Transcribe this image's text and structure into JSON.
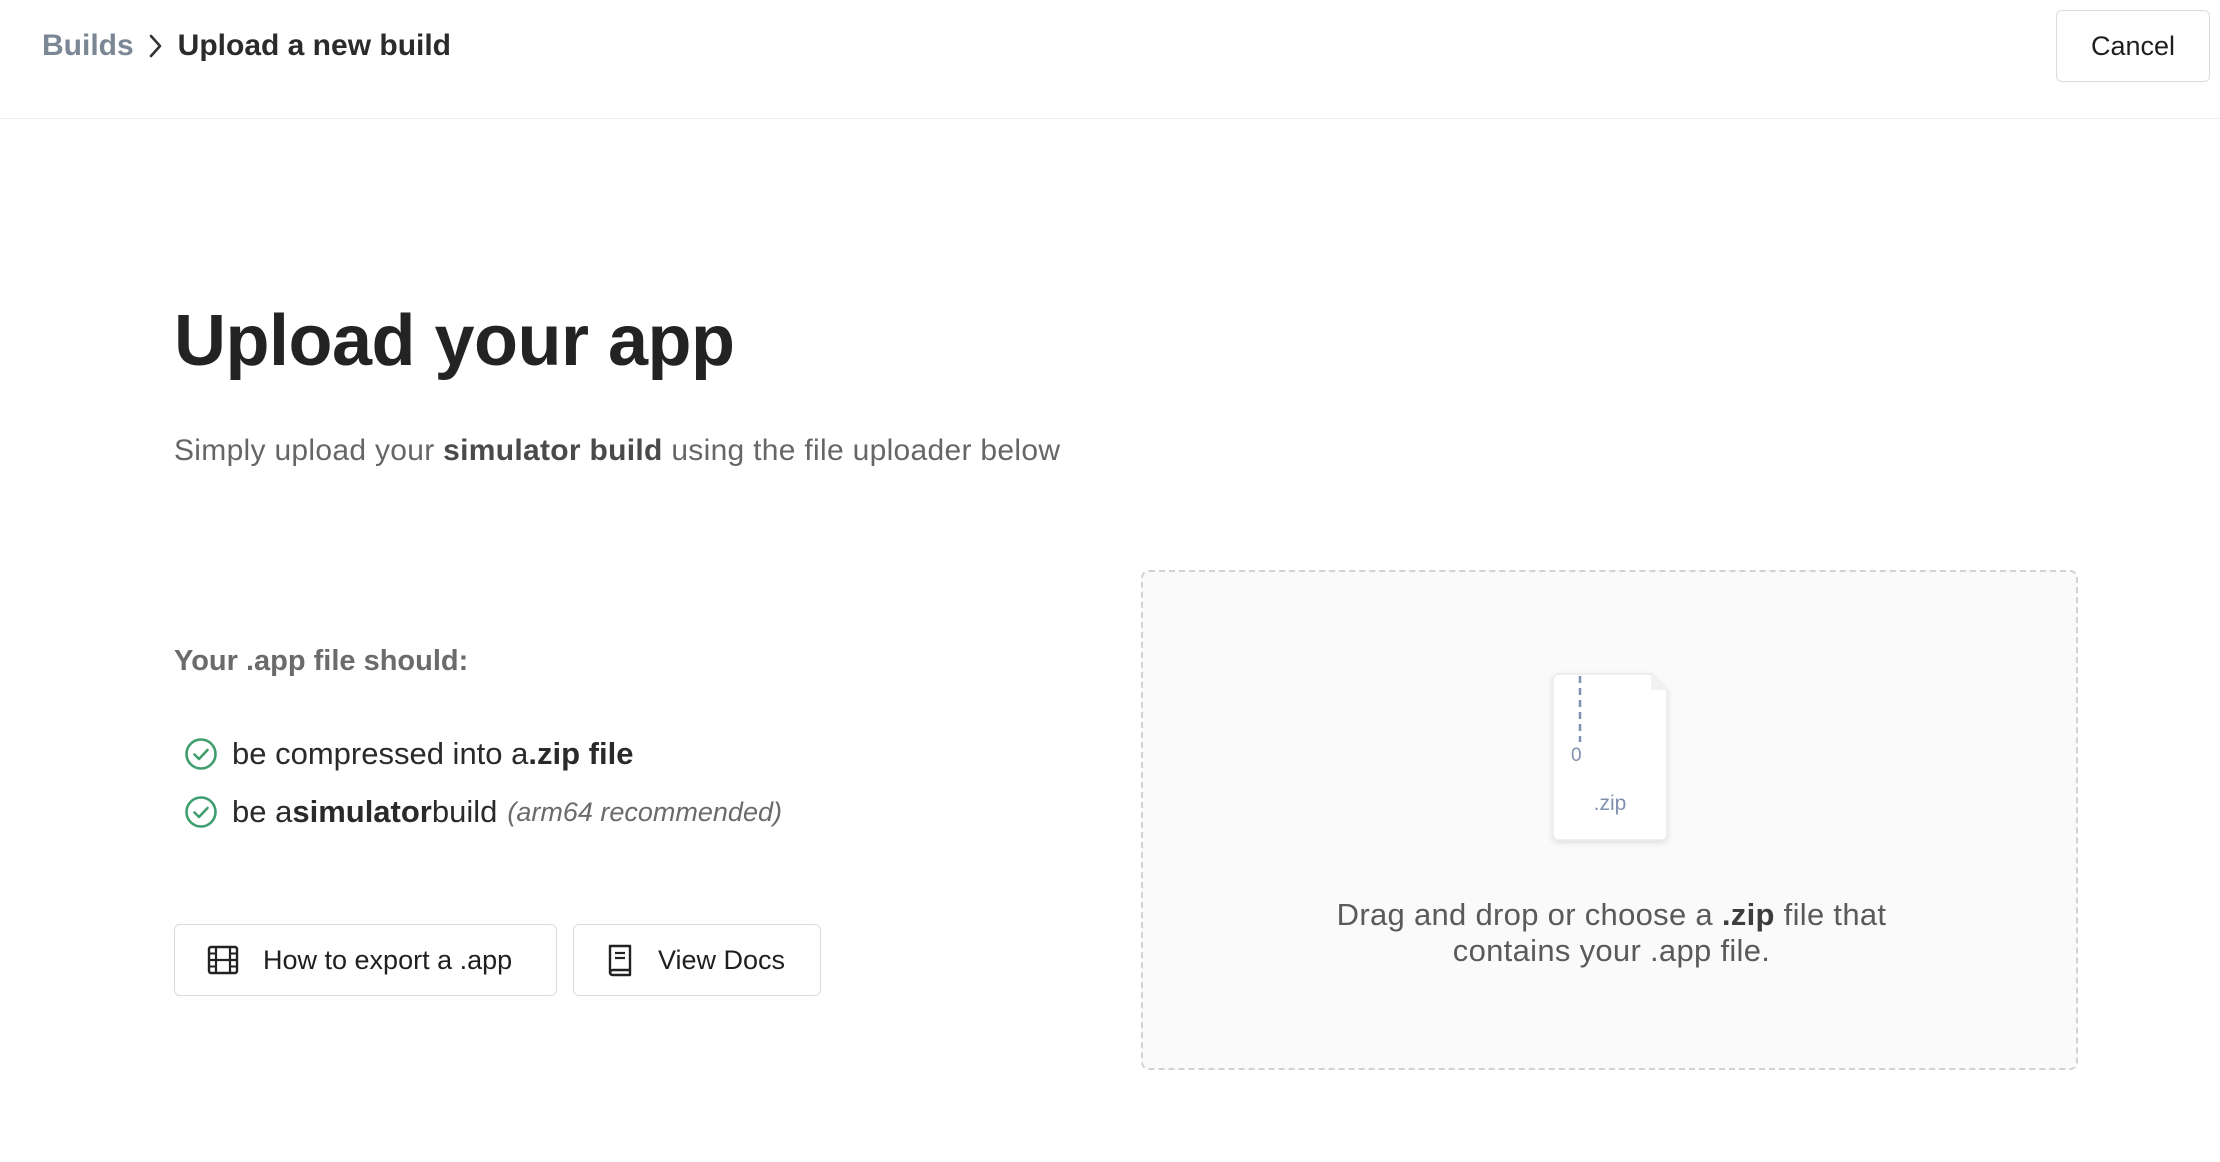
{
  "header": {
    "breadcrumb_root": "Builds",
    "breadcrumb_current": "Upload a new build",
    "cancel_label": "Cancel"
  },
  "main": {
    "title": "Upload your app",
    "subtitle_pre": "Simply upload your ",
    "subtitle_bold": "simulator build",
    "subtitle_post": " using the file uploader below",
    "requirements_heading": "Your .app file should:",
    "requirements": [
      {
        "pre": "be compressed into a ",
        "bold": ".zip file",
        "post": "",
        "note": ""
      },
      {
        "pre": "be a ",
        "bold": "simulator",
        "post": " build",
        "note": "(arm64 recommended)"
      }
    ],
    "export_button_label": "How to export a .app",
    "docs_button_label": "View Docs"
  },
  "dropzone": {
    "file_label": ".zip",
    "file_counter": "0",
    "text_pre": "Drag and drop or choose a ",
    "text_bold": ".zip",
    "text_mid": " file that",
    "text_line2": "contains your .app file."
  },
  "colors": {
    "check_green": "#3f9e6e",
    "border": "#dcdcdc",
    "muted": "#7b8794"
  },
  "icons": {
    "breadcrumb_separator": "chevron-right-icon",
    "check": "check-circle-icon",
    "export": "film-icon",
    "docs": "book-icon",
    "file": "file-icon"
  }
}
